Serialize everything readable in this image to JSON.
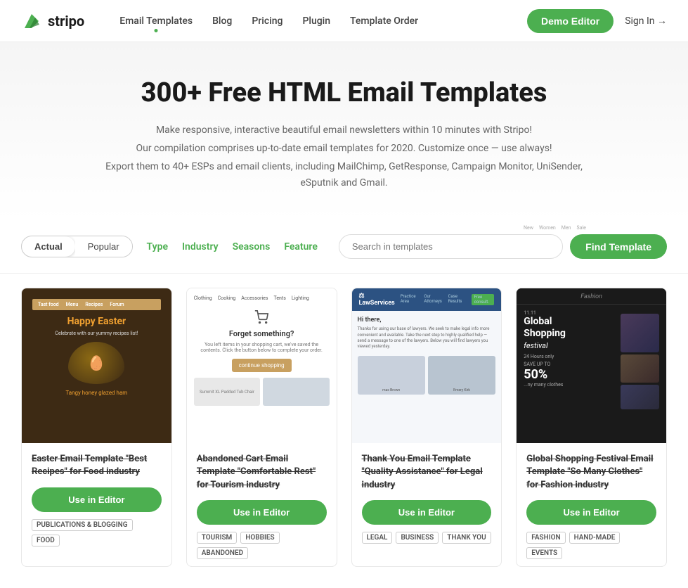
{
  "nav": {
    "logo_text": "stripo",
    "links": [
      {
        "label": "Email Templates",
        "active": true
      },
      {
        "label": "Blog",
        "active": false
      },
      {
        "label": "Pricing",
        "active": false
      },
      {
        "label": "Plugin",
        "active": false
      },
      {
        "label": "Template Order",
        "active": false
      }
    ],
    "demo_btn": "Demo Editor",
    "signin": "Sign In →"
  },
  "hero": {
    "title": "300+ Free HTML Email Templates",
    "desc1": "Make responsive, interactive beautiful email newsletters within 10 minutes with Stripo!",
    "desc2": "Our compilation comprises up-to-date email templates for 2020. Customize once — use always!",
    "desc3": "Export them to 40+ ESPs and email clients, including MailChimp, GetResponse, Campaign Monitor, UniSender, eSputnik and Gmail."
  },
  "filters": {
    "toggle_actual": "Actual",
    "toggle_popular": "Popular",
    "type": "Type",
    "industry": "Industry",
    "seasons": "Seasons",
    "feature": "Feature",
    "search_placeholder": "Search in templates",
    "find_btn": "Find Template"
  },
  "cards": [
    {
      "title": "Easter Email Template \"Best Recipes\" for Food industry",
      "use_btn": "Use in Editor",
      "tags": [
        "PUBLICATIONS & BLOGGING",
        "FOOD"
      ]
    },
    {
      "title": "Abandoned Cart Email Template \"Comfortable Rest\" for Tourism industry",
      "use_btn": "Use in Editor",
      "tags": [
        "TOURISM",
        "HOBBIES",
        "ABANDONED"
      ]
    },
    {
      "title": "Thank You Email Template \"Quality Assistance\" for Legal industry",
      "use_btn": "Use in Editor",
      "tags": [
        "LEGAL",
        "BUSINESS",
        "THANK YOU"
      ]
    },
    {
      "title": "Global Shopping Festival Email Template \"So Many Clothes\" for Fashion industry",
      "use_btn": "Use in Editor",
      "tags": [
        "FASHION",
        "HAND-MADE",
        "EVENTS"
      ]
    }
  ]
}
